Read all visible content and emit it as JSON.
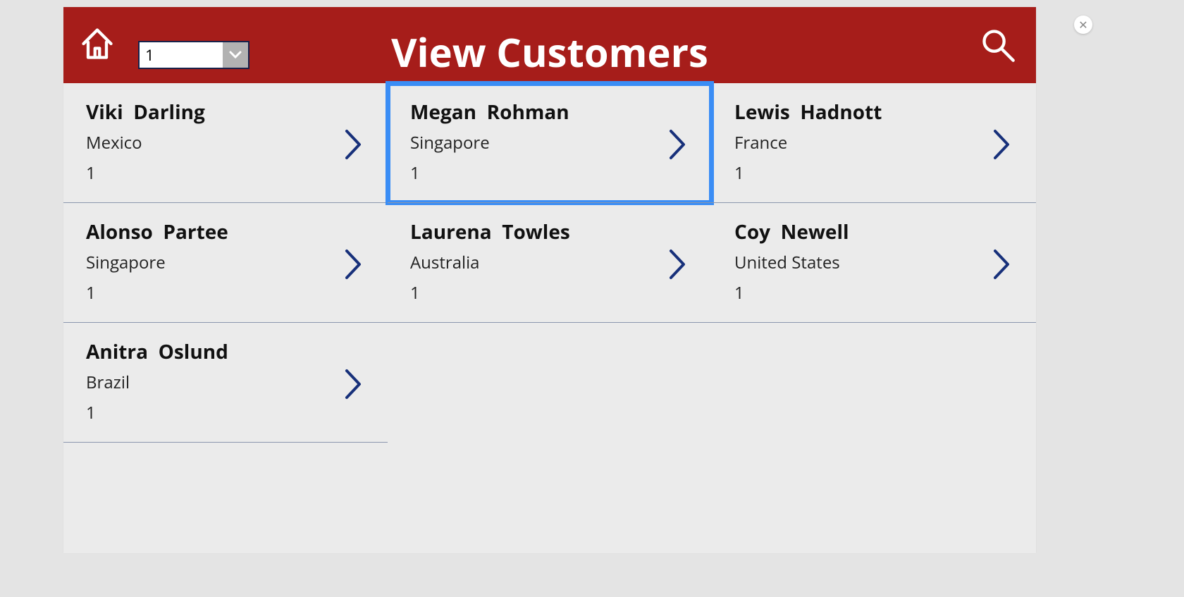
{
  "header": {
    "title": "View Customers",
    "page_value": "1"
  },
  "customers": [
    {
      "name": "Viki  Darling",
      "country": "Mexico",
      "num": "1",
      "selected": false
    },
    {
      "name": "Megan  Rohman",
      "country": "Singapore",
      "num": "1",
      "selected": true
    },
    {
      "name": "Lewis  Hadnott",
      "country": "France",
      "num": "1",
      "selected": false
    },
    {
      "name": "Alonso  Partee",
      "country": "Singapore",
      "num": "1",
      "selected": false
    },
    {
      "name": "Laurena  Towles",
      "country": "Australia",
      "num": "1",
      "selected": false
    },
    {
      "name": "Coy  Newell",
      "country": "United States",
      "num": "1",
      "selected": false
    },
    {
      "name": "Anitra  Oslund",
      "country": "Brazil",
      "num": "1",
      "selected": false
    }
  ]
}
